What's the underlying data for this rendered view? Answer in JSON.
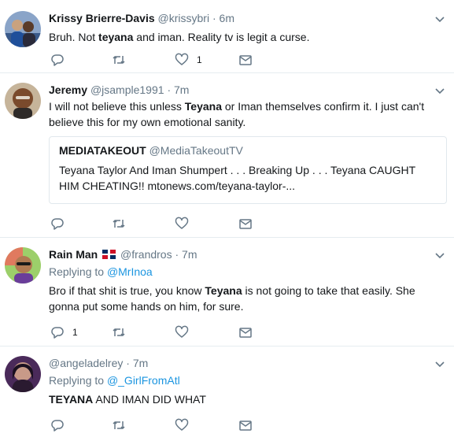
{
  "tweets": [
    {
      "name": "Krissy Brierre-Davis",
      "handle": "@krissybri",
      "dot": "·",
      "time": "6m",
      "text_pre": "Bruh. Not ",
      "text_bold": "teyana",
      "text_post": " and iman. Reality tv is legit a curse.",
      "reply_count": "",
      "like_count": "1"
    },
    {
      "name": "Jeremy",
      "handle": "@jsample1991",
      "dot": "·",
      "time": "7m",
      "text_pre": "I will not believe this unless ",
      "text_bold": "Teyana",
      "text_post": " or Iman themselves confirm it. I just can't believe this for my own emotional sanity.",
      "quote": {
        "name": "MEDIATAKEOUT",
        "handle": "@MediaTakeoutTV",
        "text": "Teyana Taylor And Iman Shumpert . . . Breaking Up . . . Teyana CAUGHT HIM CHEATING!! mtonews.com/teyana-taylor-..."
      }
    },
    {
      "name": "Rain Man",
      "flag": "dominican-republic-flag",
      "handle": "@frandros",
      "dot": "·",
      "time": "7m",
      "replying_label": "Replying to",
      "replying_to": "@MrInoa",
      "text_pre": "Bro if that shit is true, you know ",
      "text_bold": "Teyana",
      "text_post": " is not going to take that easily. She gonna put some hands on him, for sure.",
      "reply_count": "1"
    },
    {
      "name": "",
      "handle": "@angeladelrey",
      "dot": "·",
      "time": "7m",
      "replying_label": "Replying to",
      "replying_to": "@_GirlFromAtl",
      "text_pre": "",
      "text_bold": "TEYANA",
      "text_post": " AND IMAN DID WHAT"
    }
  ],
  "icons": {
    "reply": "reply-icon",
    "retweet": "retweet-icon",
    "like": "heart-icon",
    "dm": "envelope-icon",
    "more": "chevron-down-icon"
  },
  "colors": {
    "icon": "#657786",
    "link": "#1b95e0",
    "text": "#14171a",
    "border": "#e6ecf0"
  }
}
